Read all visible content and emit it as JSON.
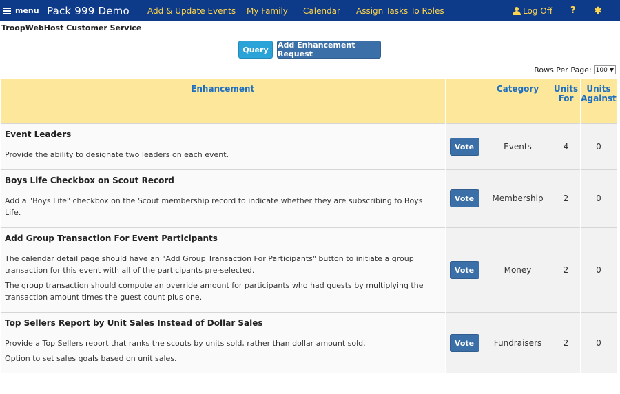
{
  "nav": {
    "menu_label": "menu",
    "brand": "Pack 999 Demo",
    "links": [
      "Add & Update Events",
      "My Family",
      "Calendar",
      "Assign Tasks To Roles"
    ],
    "logoff": "Log Off",
    "help": "?",
    "settings_icon": "gear-icon"
  },
  "page": {
    "heading": "TroopWebHost Customer Service",
    "query_button": "Query",
    "add_button": "Add Enhancement Request",
    "rows_per_page_label": "Rows Per Page:",
    "rows_per_page_value": "100"
  },
  "table": {
    "headers": {
      "enhancement": "Enhancement",
      "category": "Category",
      "units_for": "Units For",
      "units_against": "Units Against"
    },
    "vote_label": "Vote",
    "rows": [
      {
        "title": "Event Leaders",
        "descriptions": [
          "Provide the ability to designate two leaders on each event."
        ],
        "category": "Events",
        "units_for": "4",
        "units_against": "0"
      },
      {
        "title": "Boys Life Checkbox on Scout Record",
        "descriptions": [
          "Add a \"Boys Life\" checkbox on the Scout membership record to indicate whether they are subscribing to Boys Life."
        ],
        "category": "Membership",
        "units_for": "2",
        "units_against": "0"
      },
      {
        "title": "Add Group Transaction For Event Participants",
        "descriptions": [
          "The calendar detail page should have an \"Add Group Transaction For Participants\" button to initiate a group transaction for this event with all of the participants pre-selected.",
          "The group transaction should compute an override amount for participants who had guests by multiplying the transaction amount times the guest count plus one."
        ],
        "category": "Money",
        "units_for": "2",
        "units_against": "0"
      },
      {
        "title": "Top Sellers Report by Unit Sales Instead of Dollar Sales",
        "descriptions": [
          "Provide a Top Sellers report that ranks the scouts by units sold, rather than dollar amount sold.",
          "Option to set sales goals based on unit sales."
        ],
        "category": "Fundraisers",
        "units_for": "2",
        "units_against": "0"
      }
    ]
  }
}
